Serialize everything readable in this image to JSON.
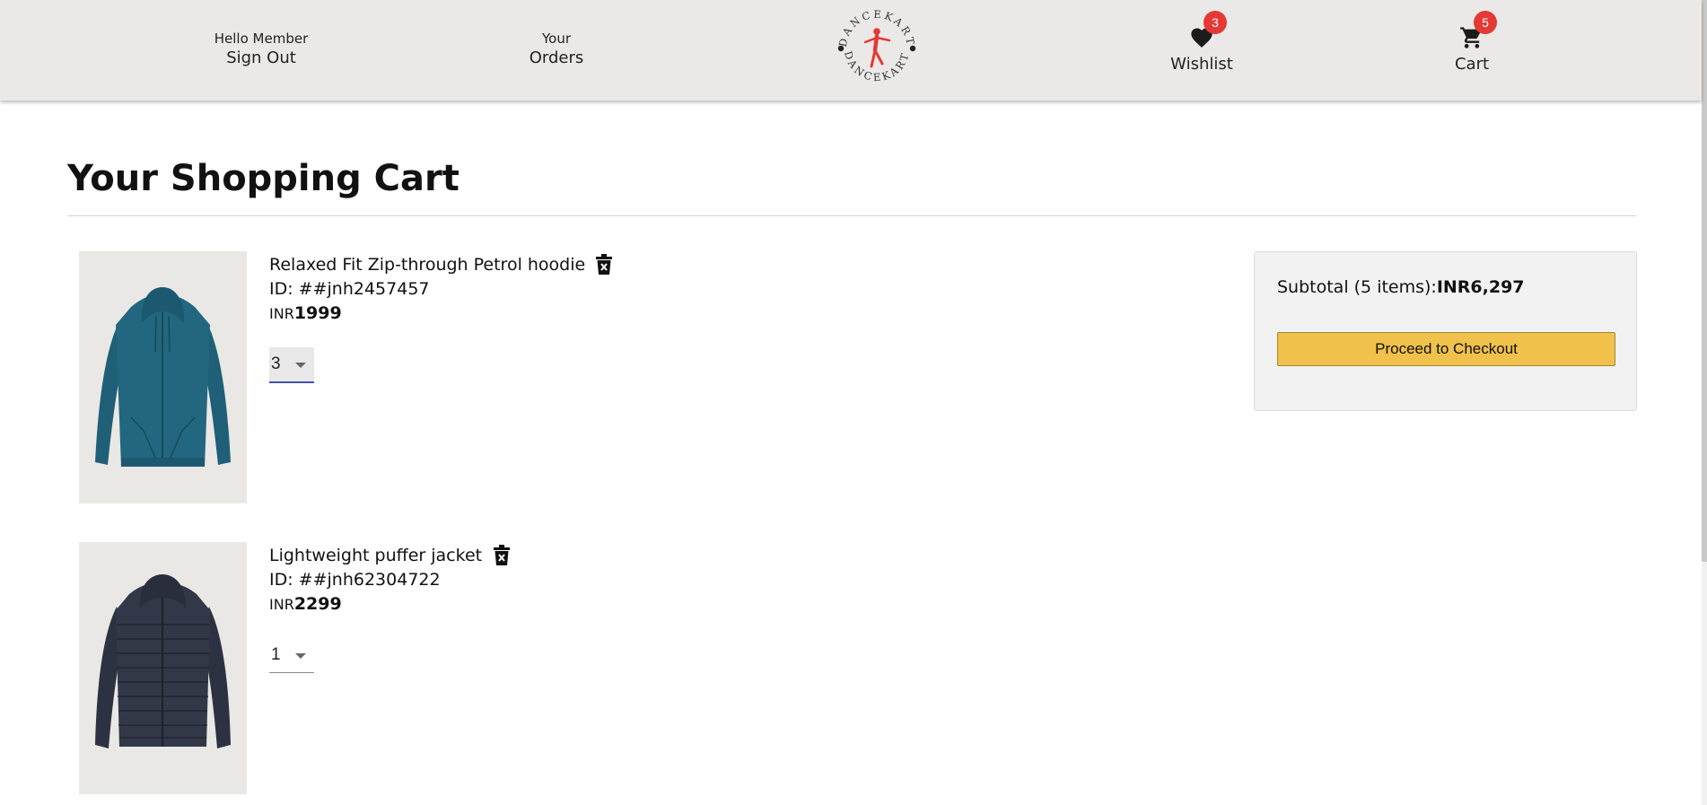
{
  "header": {
    "account": {
      "greeting": "Hello Member",
      "action": "Sign Out"
    },
    "orders": {
      "top": "Your",
      "label": "Orders"
    },
    "logo": {
      "text": "DANCEKART",
      "icon": "dancer-logo-icon",
      "brand_color": "#e53935"
    },
    "wishlist": {
      "label": "Wishlist",
      "count": "3",
      "icon": "heart-icon"
    },
    "cart": {
      "label": "Cart",
      "count": "5",
      "icon": "cart-icon"
    }
  },
  "page": {
    "title": "Your Shopping Cart"
  },
  "cart_items": [
    {
      "name": "Relaxed Fit Zip-through Petrol hoodie",
      "id": "ID: ##jnh2457457",
      "currency": "INR",
      "price": "1999",
      "quantity": "3",
      "image": "petrol-hoodie-image"
    },
    {
      "name": "Lightweight puffer jacket",
      "id": "ID: ##jnh62304722",
      "currency": "INR",
      "price": "2299",
      "quantity": "1",
      "image": "puffer-jacket-image"
    }
  ],
  "summary": {
    "subtotal_label": "Subtotal (5 items):",
    "subtotal_value": "INR6,297",
    "checkout_label": "Proceed to Checkout",
    "button_color": "#f0c14b"
  }
}
